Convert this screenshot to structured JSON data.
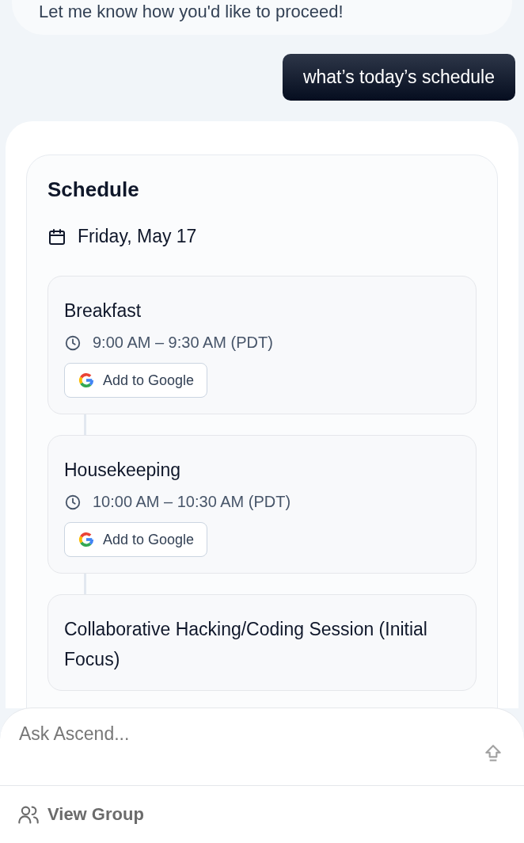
{
  "previous_message": "Let me know how you'd like to proceed!",
  "user_message": "what’s today’s schedule",
  "schedule": {
    "title": "Schedule",
    "date": "Friday, May 17",
    "events": [
      {
        "title": "Breakfast",
        "time": "9:00 AM – 9:30 AM (PDT)",
        "button": "Add to Google"
      },
      {
        "title": "Housekeeping",
        "time": "10:00 AM – 10:30 AM (PDT)",
        "button": "Add to Google"
      },
      {
        "title": "Collaborative Hacking/Coding Session (Initial Focus)"
      }
    ]
  },
  "composer": {
    "placeholder": "Ask Ascend..."
  },
  "footer": {
    "view_group": "View Group"
  }
}
